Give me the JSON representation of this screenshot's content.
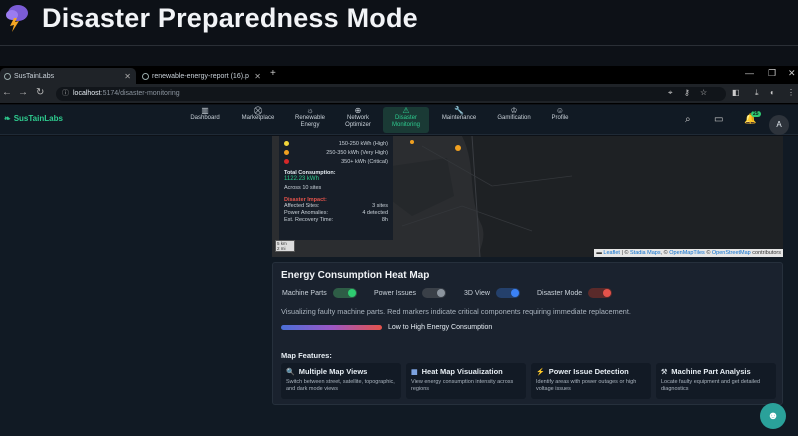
{
  "slide": {
    "title": "Disaster Preparedness Mode"
  },
  "browser": {
    "tabs": [
      {
        "label": "SusTainLabs",
        "active": true
      },
      {
        "label": "renewable-energy-report (16).p",
        "active": false
      }
    ],
    "url_host": "localhost",
    "url_path": ":5174/disaster-monitoring"
  },
  "app": {
    "brand": "SusTainLabs",
    "nav": [
      {
        "label": "Dashboard",
        "icon": "chart-icon"
      },
      {
        "label": "Marketplace",
        "icon": "cart-icon"
      },
      {
        "label": "Renewable Energy",
        "icon": "sun-icon"
      },
      {
        "label": "Network Optimizer",
        "icon": "network-icon"
      },
      {
        "label": "Disaster Monitoring",
        "icon": "warning-icon",
        "active": true
      },
      {
        "label": "Maintenance",
        "icon": "wrench-icon"
      },
      {
        "label": "Gamification",
        "icon": "trophy-icon"
      },
      {
        "label": "Profile",
        "icon": "user-icon"
      }
    ],
    "notif_count": "25",
    "avatar_letter": "A"
  },
  "map_legend": {
    "ranges": [
      {
        "label": "150-250 kWh (High)",
        "color": "#f1d53a"
      },
      {
        "label": "250-350 kWh (Very High)",
        "color": "#f0a020"
      },
      {
        "label": "350+ kWh (Critical)",
        "color": "#d62828"
      }
    ],
    "total_title": "Total Consumption:",
    "total_value": "1122.23 kWh",
    "total_sites": "Across 10 sites",
    "impact_title": "Disaster Impact:",
    "impact": [
      {
        "k": "Affected Sites:",
        "v": "3 sites"
      },
      {
        "k": "Power Anomalies:",
        "v": "4 detected"
      },
      {
        "k": "Est. Recovery Time:",
        "v": "8h"
      }
    ],
    "scale_top": "5 km",
    "scale_bottom": "2 mi"
  },
  "map_attr": {
    "leaflet": "Leaflet",
    "sep1": " | © ",
    "stadia": "Stadia Maps",
    "sep2": ", © ",
    "omt": "OpenMapTiles",
    "sep3": " © ",
    "osm": "OpenStreetMap",
    "tail": " contributors"
  },
  "panel": {
    "title": "Energy Consumption Heat Map",
    "toggles": [
      {
        "label": "Machine Parts",
        "on": true,
        "color": "#2ecc71"
      },
      {
        "label": "Power Issues",
        "on": false,
        "color": "#8b949e"
      },
      {
        "label": "3D View",
        "on": true,
        "color": "#3b82f6"
      },
      {
        "label": "Disaster Mode",
        "on": true,
        "color": "#e5534b"
      }
    ],
    "description": "Visualizing faulty machine parts. Red markers indicate critical components requiring immediate replacement.",
    "gradient_label": "Low to High Energy Consumption",
    "features_title": "Map Features:",
    "features": [
      {
        "title": "Multiple Map Views",
        "desc": "Switch between street, satellite, topographic, and dark mode views",
        "icon": "search-icon"
      },
      {
        "title": "Heat Map Visualization",
        "desc": "View energy consumption intensity across regions",
        "icon": "chart-icon"
      },
      {
        "title": "Power Issue Detection",
        "desc": "Identify areas with power outages or high voltage issues",
        "icon": "lightning-icon"
      },
      {
        "title": "Machine Part Analysis",
        "desc": "Locate faulty equipment and get detailed diagnostics",
        "icon": "tools-icon"
      }
    ]
  }
}
